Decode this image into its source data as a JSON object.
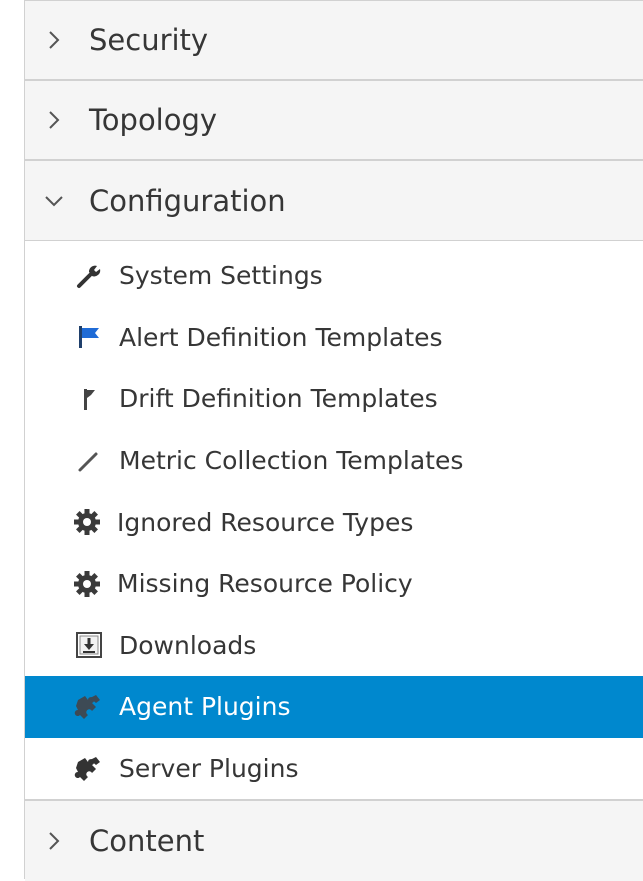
{
  "sections": {
    "security": {
      "label": "Security",
      "chevron": "chevron-right-icon"
    },
    "topology": {
      "label": "Topology",
      "chevron": "chevron-right-icon"
    },
    "configuration": {
      "label": "Configuration",
      "chevron": "chevron-down-icon",
      "items": [
        {
          "label": "System Settings",
          "icon": "wrench-icon"
        },
        {
          "label": "Alert Definition Templates",
          "icon": "flag-icon"
        },
        {
          "label": "Drift Definition Templates",
          "icon": "drift-flag-icon"
        },
        {
          "label": "Metric Collection Templates",
          "icon": "pencil-icon"
        },
        {
          "label": "Ignored Resource Types",
          "icon": "gear-icon"
        },
        {
          "label": "Missing Resource Policy",
          "icon": "gear-icon"
        },
        {
          "label": "Downloads",
          "icon": "download-icon"
        },
        {
          "label": "Agent Plugins",
          "icon": "puzzle-icon",
          "selected": true
        },
        {
          "label": "Server Plugins",
          "icon": "puzzle-icon"
        }
      ]
    },
    "content": {
      "label": "Content",
      "chevron": "chevron-right-icon"
    }
  },
  "colors": {
    "selected_bg": "#0088ce",
    "header_bg": "#f5f5f5",
    "flag_blue": "#1f6bd6"
  }
}
